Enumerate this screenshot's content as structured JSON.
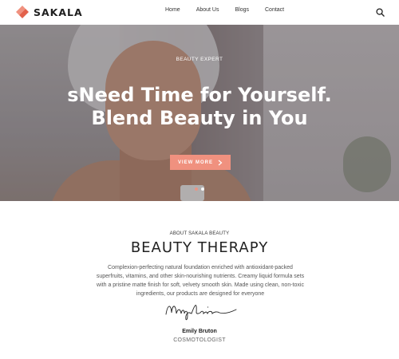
{
  "brand": {
    "name": "SAKALA",
    "accent": "#f0917f"
  },
  "nav": {
    "items": [
      "Home",
      "About Us",
      "Blogs",
      "Contact"
    ]
  },
  "header": {
    "search_icon": "search-icon"
  },
  "hero": {
    "kicker": "BEAUTY EXPERT",
    "headline_line1": "sNeed Time for Yourself.",
    "headline_line2": "Blend Beauty in You",
    "button_label": "VIEW MORE",
    "slides_total": 2,
    "active_slide": 1
  },
  "about": {
    "kicker": "ABOUT SAKALA BEAUTY",
    "title": "BEAUTY THERAPY",
    "text": "Complexion-perfecting natural foundation enriched with antioxidant-packed superfruits, vitamins, and other skin-nourishing nutrients. Creamy liquid formula sets with a pristine matte finish for soft, velvety smooth skin. Made using clean, non-toxic ingredients, our products are designed for everyone",
    "signature_text": "Mayline",
    "person_name": "Emily Bruton",
    "person_role": "COSMOTOLOGIST"
  }
}
